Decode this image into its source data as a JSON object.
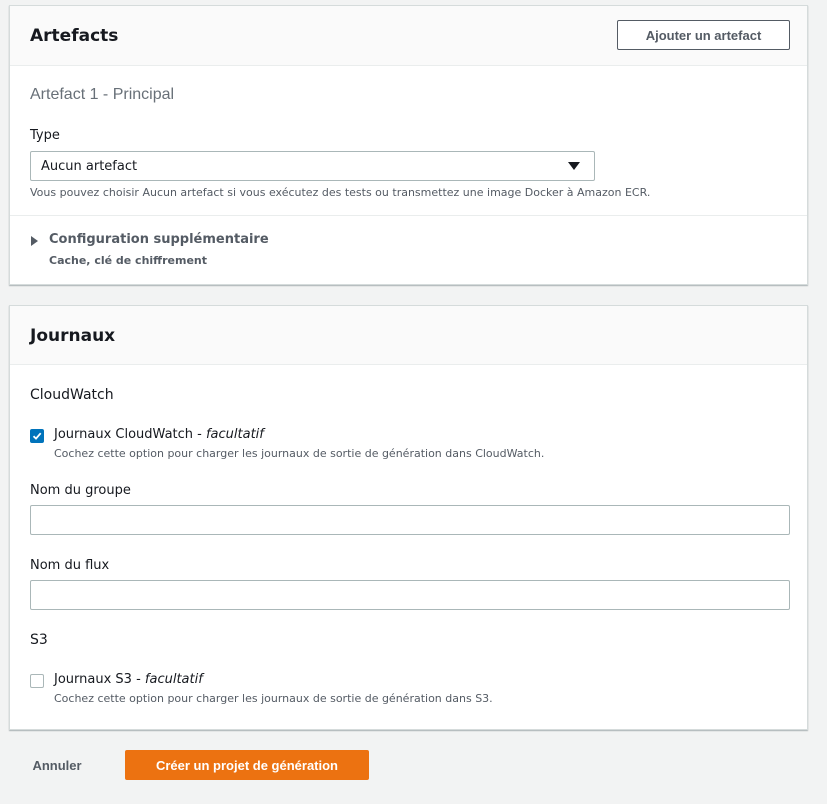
{
  "artefacts": {
    "title": "Artefacts",
    "add_button": "Ajouter un artefact",
    "section_heading": "Artefact 1 - Principal",
    "type_label": "Type",
    "type_value": "Aucun artefact",
    "type_hint": "Vous pouvez choisir Aucun artefact si vous exécutez des tests ou transmettez une image Docker à Amazon ECR.",
    "extra_config_title": "Configuration supplémentaire",
    "extra_config_subtitle": "Cache, clé de chiffrement"
  },
  "journaux": {
    "title": "Journaux",
    "cloudwatch": {
      "heading": "CloudWatch",
      "checkbox_label": "Journaux CloudWatch - ",
      "checkbox_optional": "facultatif",
      "checked": true,
      "description": "Cochez cette option pour charger les journaux de sortie de génération dans CloudWatch.",
      "group_label": "Nom du groupe",
      "group_value": "",
      "stream_label": "Nom du flux",
      "stream_value": ""
    },
    "s3": {
      "heading": "S3",
      "checkbox_label": "Journaux S3 - ",
      "checkbox_optional": "facultatif",
      "checked": false,
      "description": "Cochez cette option pour charger les journaux de sortie de génération dans S3."
    }
  },
  "footer": {
    "cancel": "Annuler",
    "create": "Créer un projet de génération"
  },
  "colors": {
    "primary_button": "#ec7211",
    "checkbox_checked": "#0073bb"
  }
}
